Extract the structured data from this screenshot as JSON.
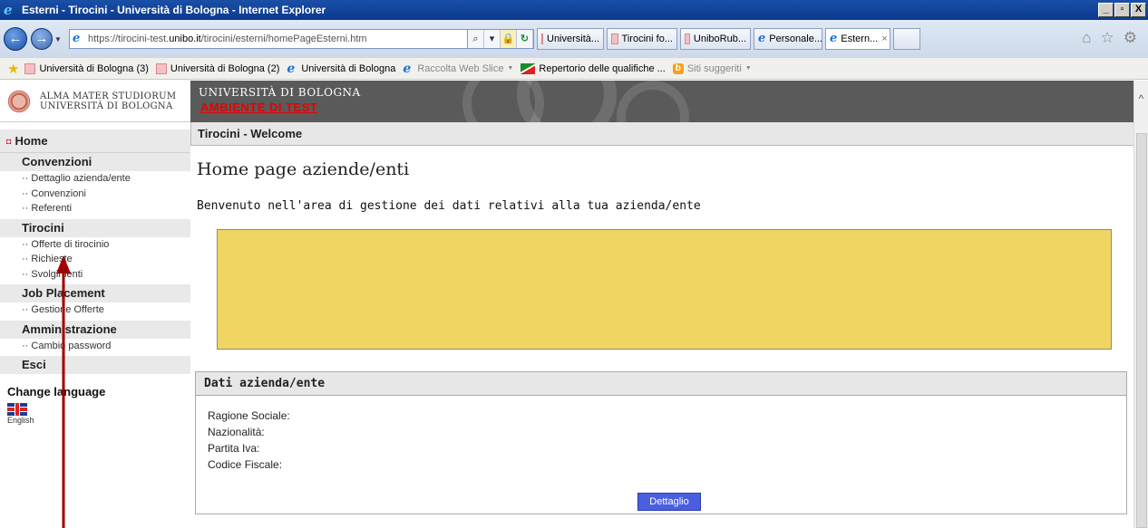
{
  "window": {
    "title": "Esterni - Tirocini - Università di Bologna - Internet Explorer",
    "controls": [
      "_",
      "▫",
      "X"
    ]
  },
  "address": {
    "url_prefix": "https://tirocini-test.",
    "url_domain": "unibo.it",
    "url_path": "/tirocini/esterni/homePageEsterni.htm"
  },
  "tabs": [
    {
      "label": "Università...",
      "icon": "unibo-favicon"
    },
    {
      "label": "Tirocini fo...",
      "icon": "unibo-favicon"
    },
    {
      "label": "UniboRub...",
      "icon": "unibo-favicon"
    },
    {
      "label": "Personale...",
      "icon": "ie-icon"
    },
    {
      "label": "Estern...",
      "icon": "ie-icon",
      "close": "×"
    }
  ],
  "favorites": [
    {
      "label": "Università di Bologna (3)",
      "icon": "unibo-favicon"
    },
    {
      "label": "Università di Bologna (2)",
      "icon": "unibo-favicon"
    },
    {
      "label": "Università di Bologna",
      "icon": "ie-icon"
    },
    {
      "label": "Raccolta Web Slice",
      "icon": "ie-icon"
    },
    {
      "label": "Repertorio delle qualifiche ...",
      "icon": "flag-icon"
    },
    {
      "label": "Siti suggeriti",
      "icon": "bing-icon"
    }
  ],
  "header": {
    "logo_line1": "ALMA MATER STUDIORUM",
    "logo_line2": "UNIVERSITÀ DI BOLOGNA",
    "banner_title": "UNIVERSITÀ DI BOLOGNA",
    "banner_env": "AMBIENTE DI TEST"
  },
  "sidebar": {
    "home": "Home",
    "sections": [
      {
        "title": "Convenzioni",
        "items": [
          "·· Dettaglio azienda/ente",
          "·· Convenzioni",
          "·· Referenti"
        ]
      },
      {
        "title": "Tirocini",
        "items": [
          "·· Offerte di tirocinio",
          "·· Richieste",
          "·· Svolgimenti"
        ]
      },
      {
        "title": "Job Placement",
        "items": [
          "·· Gestione Offerte"
        ]
      },
      {
        "title": "Amministrazione",
        "items": [
          "·· Cambio password"
        ]
      },
      {
        "title": "Esci",
        "items": []
      }
    ],
    "change_language": "Change language",
    "language": "English"
  },
  "main": {
    "breadcrumb": "Tirocini - Welcome",
    "heading": "Home page aziende/enti",
    "welcome": "Benvenuto nell'area di gestione dei dati relativi alla tua azienda/ente",
    "panel_title": "Dati azienda/ente",
    "fields": [
      "Ragione Sociale:",
      "Nazionalità:",
      "Partita Iva:",
      "Codice Fiscale:"
    ],
    "detail_button": "Dettaglio"
  },
  "colors": {
    "notice_box": "#f1d562",
    "banner": "#5a5a5a",
    "test_label": "#e80000",
    "button": "#4a5fe0",
    "annotation_arrow": "#a00000"
  }
}
